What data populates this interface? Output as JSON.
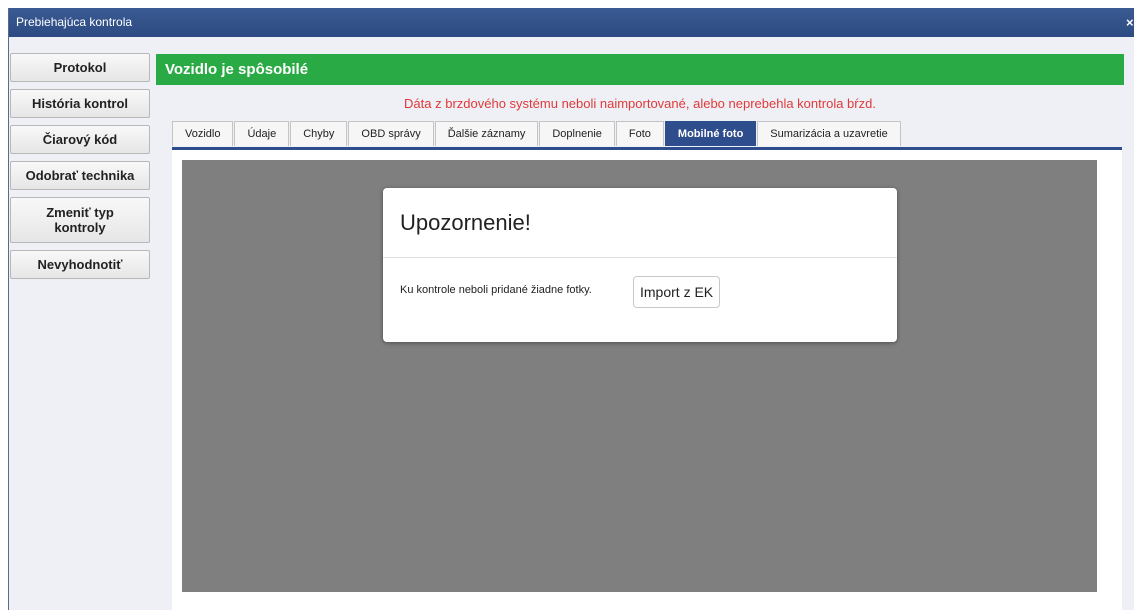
{
  "window": {
    "title": "Prebiehajúca kontrola",
    "close_glyph": "×"
  },
  "sidebar": {
    "buttons": [
      {
        "label": "Protokol"
      },
      {
        "label": "História kontrol"
      },
      {
        "label": "Čiarový kód"
      },
      {
        "label": "Odobrať technika"
      },
      {
        "label_line1": "Zmeniť typ",
        "label_line2": "kontroly"
      },
      {
        "label": "Nevyhodnotiť"
      }
    ]
  },
  "status_bar": {
    "text": "Vozidlo je spôsobilé",
    "color": "#2aaa44"
  },
  "warning": {
    "text": "Dáta z brzdového systému neboli naimportované, alebo neprebehla kontrola bŕzd.",
    "color": "#e03a3a"
  },
  "tabs": [
    {
      "label": "Vozidlo"
    },
    {
      "label": "Údaje"
    },
    {
      "label": "Chyby"
    },
    {
      "label": "OBD správy"
    },
    {
      "label": "Ďalšie záznamy"
    },
    {
      "label": "Doplnenie"
    },
    {
      "label": "Foto"
    },
    {
      "label": "Mobilné foto",
      "active": true
    },
    {
      "label": "Sumarizácia a uzavretie"
    }
  ],
  "modal": {
    "title": "Upozornenie!",
    "message": "Ku kontrole neboli pridané žiadne fotky.",
    "button_label": "Import z EK"
  },
  "colors": {
    "accent": "#2e4d8c",
    "titlebar": "#2d4b82",
    "overlay": "#7f7f7f"
  }
}
